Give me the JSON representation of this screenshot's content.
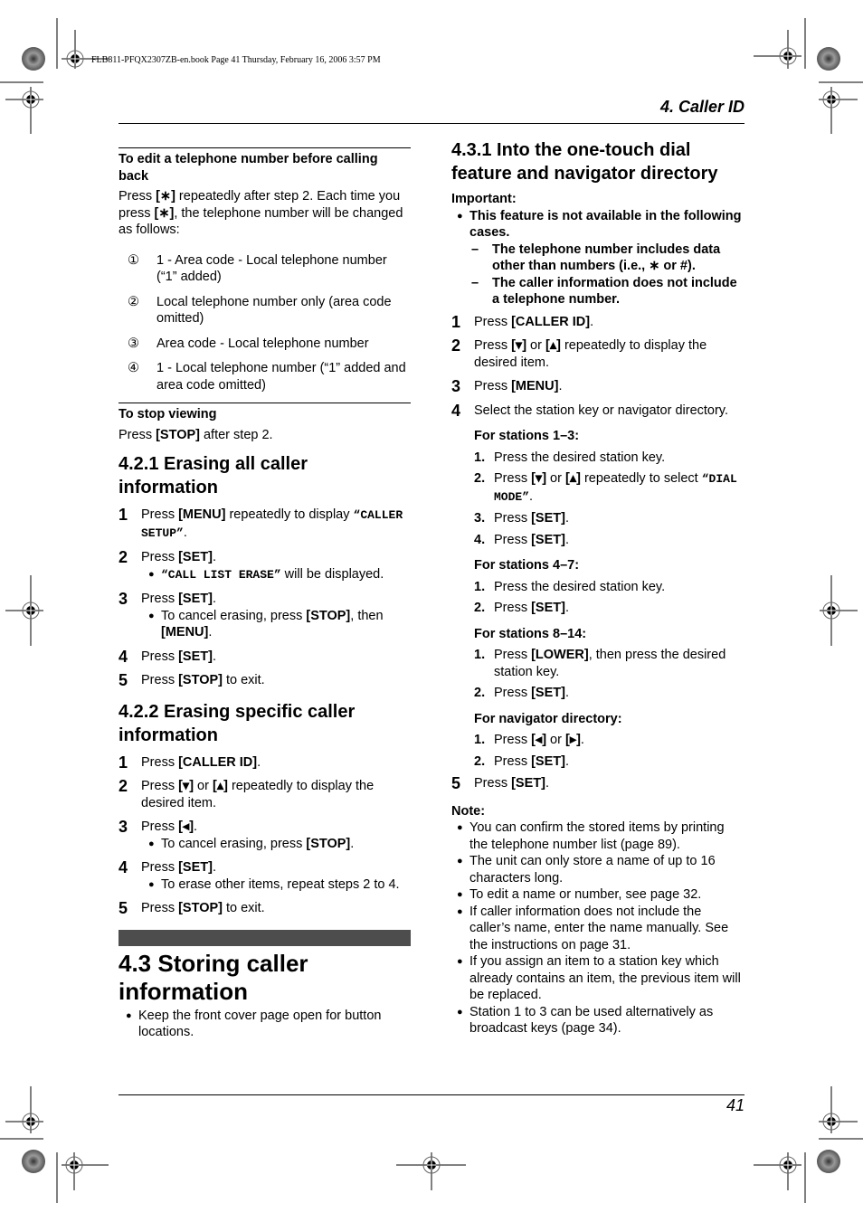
{
  "slug": "FLB811-PFQX2307ZB-en.book  Page 41  Thursday, February 16, 2006  3:57 PM",
  "header": {
    "chapter": "4. Caller ID"
  },
  "footer": {
    "page_number": "41"
  },
  "left": {
    "edit_heading": "To edit a telephone number before calling back",
    "edit_para_1": "Press ",
    "edit_key_1": "[∗]",
    "edit_para_2": " repeatedly after step 2. Each time you press ",
    "edit_key_2": "[∗]",
    "edit_para_3": ", the telephone number will be changed as follows:",
    "edit_items": [
      {
        "num": "①",
        "text": "1 - Area code - Local telephone number (“1” added)"
      },
      {
        "num": "②",
        "text": "Local telephone number only (area code omitted)"
      },
      {
        "num": "③",
        "text": "Area code - Local telephone number"
      },
      {
        "num": "④",
        "text": "1 - Local telephone number (“1” added and area code omitted)"
      }
    ],
    "stop_heading": "To stop viewing",
    "stop_pre": "Press ",
    "stop_key": "[STOP]",
    "stop_post": " after step 2.",
    "sec421": {
      "title": "4.2.1 Erasing all caller information",
      "steps": [
        {
          "num": "1",
          "pre": "Press ",
          "key": "[MENU]",
          "post": " repeatedly to display ",
          "mono": "“CALLER SETUP”",
          "end": "."
        },
        {
          "num": "2",
          "pre": "Press ",
          "key": "[SET]",
          "post": ".",
          "bullet_mono": "“CALL LIST ERASE”",
          "bullet_text": " will be displayed."
        },
        {
          "num": "3",
          "pre": "Press ",
          "key": "[SET]",
          "post": ".",
          "bullet_pre": "To cancel erasing, press ",
          "bullet_key": "[STOP]",
          "bullet_mid": ", then ",
          "bullet_key2": "[MENU]",
          "bullet_end": "."
        },
        {
          "num": "4",
          "pre": "Press ",
          "key": "[SET]",
          "post": "."
        },
        {
          "num": "5",
          "pre": "Press ",
          "key": "[STOP]",
          "post": " to exit."
        }
      ]
    },
    "sec422": {
      "title": "4.2.2 Erasing specific caller information",
      "steps": [
        {
          "num": "1",
          "pre": "Press ",
          "key": "[CALLER ID]",
          "post": "."
        },
        {
          "num": "2",
          "pre": "Press ",
          "key": "[▾]",
          "mid": " or ",
          "key2": "[▴]",
          "post": " repeatedly to display the desired item."
        },
        {
          "num": "3",
          "pre": "Press ",
          "key": "[◂]",
          "post": ".",
          "bullet_pre": "To cancel erasing, press ",
          "bullet_key": "[STOP]",
          "bullet_end": "."
        },
        {
          "num": "4",
          "pre": "Press ",
          "key": "[SET]",
          "post": ".",
          "bullet_text": "To erase other items, repeat steps 2 to 4."
        },
        {
          "num": "5",
          "pre": "Press ",
          "key": "[STOP]",
          "post": " to exit."
        }
      ]
    },
    "sec43": {
      "title": "4.3 Storing caller information",
      "bullet": "Keep the front cover page open for button locations."
    }
  },
  "right": {
    "sec431_title": "4.3.1 Into the one-touch dial feature and navigator directory",
    "important_label": "Important:",
    "important_bullet": "This feature is not available in the following cases.",
    "important_dashes": [
      "The telephone number includes data other than numbers (i.e., ∗ or #).",
      "The caller information does not include a telephone number."
    ],
    "steps": [
      {
        "num": "1",
        "pre": "Press ",
        "key": "[CALLER ID]",
        "post": "."
      },
      {
        "num": "2",
        "pre": "Press ",
        "key": "[▾]",
        "mid": " or ",
        "key2": "[▴]",
        "post": " repeatedly to display the desired item."
      },
      {
        "num": "3",
        "pre": "Press ",
        "key": "[MENU]",
        "post": "."
      },
      {
        "num": "4",
        "text": "Select the station key or navigator directory."
      },
      {
        "num": "5",
        "pre": "Press ",
        "key": "[SET]",
        "post": "."
      }
    ],
    "groups": [
      {
        "heading": "For stations 1–3:",
        "items": [
          {
            "n": "1.",
            "text": "Press the desired station key."
          },
          {
            "n": "2.",
            "pre": "Press ",
            "key": "[▾]",
            "mid": " or ",
            "key2": "[▴]",
            "post": " repeatedly to select ",
            "mono": "“DIAL MODE”",
            "end": "."
          },
          {
            "n": "3.",
            "pre": "Press ",
            "key": "[SET]",
            "post": "."
          },
          {
            "n": "4.",
            "pre": "Press ",
            "key": "[SET]",
            "post": "."
          }
        ]
      },
      {
        "heading": "For stations 4–7:",
        "items": [
          {
            "n": "1.",
            "text": "Press the desired station key."
          },
          {
            "n": "2.",
            "pre": "Press ",
            "key": "[SET]",
            "post": "."
          }
        ]
      },
      {
        "heading": "For stations 8–14:",
        "items": [
          {
            "n": "1.",
            "pre": "Press ",
            "key": "[LOWER]",
            "post": ", then press the desired station key."
          },
          {
            "n": "2.",
            "pre": "Press ",
            "key": "[SET]",
            "post": "."
          }
        ]
      },
      {
        "heading": "For navigator directory:",
        "items": [
          {
            "n": "1.",
            "pre": "Press ",
            "key": "[◂]",
            "mid": " or ",
            "key2": "[▸]",
            "post": "."
          },
          {
            "n": "2.",
            "pre": "Press ",
            "key": "[SET]",
            "post": "."
          }
        ]
      }
    ],
    "note_label": "Note:",
    "notes": [
      "You can confirm the stored items by printing the telephone number list (page 89).",
      "The unit can only store a name of up to 16 characters long.",
      "To edit a name or number, see page 32.",
      "If caller information does not include the caller’s name, enter the name manually. See the instructions on page 31.",
      "If you assign an item to a station key which already contains an item, the previous item will be replaced.",
      "Station 1 to 3 can be used alternatively as broadcast keys (page 34)."
    ]
  }
}
